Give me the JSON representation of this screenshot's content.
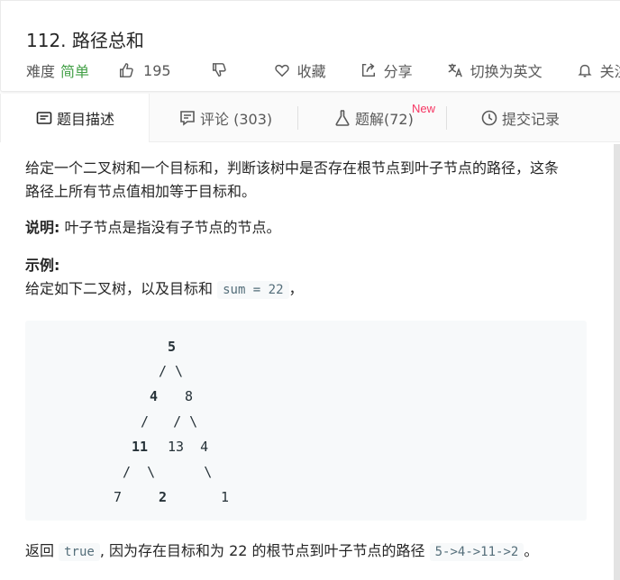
{
  "problem": {
    "title": "112. 路径总和",
    "difficulty_label": "难度",
    "difficulty_value": "简单",
    "likes": "195",
    "favorite_label": "收藏",
    "share_label": "分享",
    "switch_lang_label": "切换为英文",
    "follow_label": "关注"
  },
  "tabs": [
    {
      "label": "题目描述"
    },
    {
      "label": "评论 (303)"
    },
    {
      "label": "题解(72)"
    },
    {
      "label": "提交记录"
    }
  ],
  "new_badge": "New",
  "description": {
    "para1": "给定一个二叉树和一个目标和，判断该树中是否存在根节点到叶子节点的路径，这条路径上所有节点值相加等于目标和。",
    "note_label": "说明:",
    "note_text": " 叶子节点是指没有子节点的节点。",
    "example_title": "示例:",
    "example_intro": "给定如下二叉树，以及目标和 ",
    "sum_code": "sum = 22",
    "example_intro_end": "，",
    "tree": {
      "line1": "5",
      "line2": "/ \\",
      "line3a": "4",
      "line3b": "8",
      "line4": "/   / \\",
      "line5a": "11",
      "line5b": "13  4",
      "line6": "/  \\      \\",
      "line7a": "7",
      "line7b": "2",
      "line7c": "1"
    },
    "result_prefix": "返回 ",
    "result_true": "true",
    "result_mid": ", 因为存在目标和为 22 的根节点到叶子节点的路径 ",
    "result_path": "5->4->11->2",
    "result_end": "。"
  },
  "colors": {
    "easy": "#43a047",
    "new_badge": "#f63663",
    "code_bg": "#f7f9fa"
  }
}
